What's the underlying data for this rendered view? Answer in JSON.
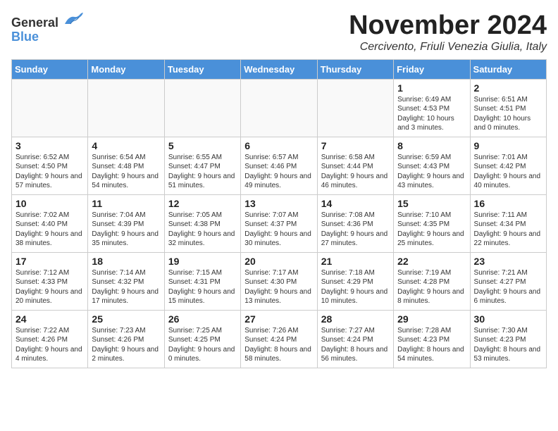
{
  "header": {
    "logo_general": "General",
    "logo_blue": "Blue",
    "month_title": "November 2024",
    "location": "Cercivento, Friuli Venezia Giulia, Italy"
  },
  "weekdays": [
    "Sunday",
    "Monday",
    "Tuesday",
    "Wednesday",
    "Thursday",
    "Friday",
    "Saturday"
  ],
  "weeks": [
    [
      {
        "day": "",
        "info": ""
      },
      {
        "day": "",
        "info": ""
      },
      {
        "day": "",
        "info": ""
      },
      {
        "day": "",
        "info": ""
      },
      {
        "day": "",
        "info": ""
      },
      {
        "day": "1",
        "info": "Sunrise: 6:49 AM\nSunset: 4:53 PM\nDaylight: 10 hours\nand 3 minutes."
      },
      {
        "day": "2",
        "info": "Sunrise: 6:51 AM\nSunset: 4:51 PM\nDaylight: 10 hours\nand 0 minutes."
      }
    ],
    [
      {
        "day": "3",
        "info": "Sunrise: 6:52 AM\nSunset: 4:50 PM\nDaylight: 9 hours\nand 57 minutes."
      },
      {
        "day": "4",
        "info": "Sunrise: 6:54 AM\nSunset: 4:48 PM\nDaylight: 9 hours\nand 54 minutes."
      },
      {
        "day": "5",
        "info": "Sunrise: 6:55 AM\nSunset: 4:47 PM\nDaylight: 9 hours\nand 51 minutes."
      },
      {
        "day": "6",
        "info": "Sunrise: 6:57 AM\nSunset: 4:46 PM\nDaylight: 9 hours\nand 49 minutes."
      },
      {
        "day": "7",
        "info": "Sunrise: 6:58 AM\nSunset: 4:44 PM\nDaylight: 9 hours\nand 46 minutes."
      },
      {
        "day": "8",
        "info": "Sunrise: 6:59 AM\nSunset: 4:43 PM\nDaylight: 9 hours\nand 43 minutes."
      },
      {
        "day": "9",
        "info": "Sunrise: 7:01 AM\nSunset: 4:42 PM\nDaylight: 9 hours\nand 40 minutes."
      }
    ],
    [
      {
        "day": "10",
        "info": "Sunrise: 7:02 AM\nSunset: 4:40 PM\nDaylight: 9 hours\nand 38 minutes."
      },
      {
        "day": "11",
        "info": "Sunrise: 7:04 AM\nSunset: 4:39 PM\nDaylight: 9 hours\nand 35 minutes."
      },
      {
        "day": "12",
        "info": "Sunrise: 7:05 AM\nSunset: 4:38 PM\nDaylight: 9 hours\nand 32 minutes."
      },
      {
        "day": "13",
        "info": "Sunrise: 7:07 AM\nSunset: 4:37 PM\nDaylight: 9 hours\nand 30 minutes."
      },
      {
        "day": "14",
        "info": "Sunrise: 7:08 AM\nSunset: 4:36 PM\nDaylight: 9 hours\nand 27 minutes."
      },
      {
        "day": "15",
        "info": "Sunrise: 7:10 AM\nSunset: 4:35 PM\nDaylight: 9 hours\nand 25 minutes."
      },
      {
        "day": "16",
        "info": "Sunrise: 7:11 AM\nSunset: 4:34 PM\nDaylight: 9 hours\nand 22 minutes."
      }
    ],
    [
      {
        "day": "17",
        "info": "Sunrise: 7:12 AM\nSunset: 4:33 PM\nDaylight: 9 hours\nand 20 minutes."
      },
      {
        "day": "18",
        "info": "Sunrise: 7:14 AM\nSunset: 4:32 PM\nDaylight: 9 hours\nand 17 minutes."
      },
      {
        "day": "19",
        "info": "Sunrise: 7:15 AM\nSunset: 4:31 PM\nDaylight: 9 hours\nand 15 minutes."
      },
      {
        "day": "20",
        "info": "Sunrise: 7:17 AM\nSunset: 4:30 PM\nDaylight: 9 hours\nand 13 minutes."
      },
      {
        "day": "21",
        "info": "Sunrise: 7:18 AM\nSunset: 4:29 PM\nDaylight: 9 hours\nand 10 minutes."
      },
      {
        "day": "22",
        "info": "Sunrise: 7:19 AM\nSunset: 4:28 PM\nDaylight: 9 hours\nand 8 minutes."
      },
      {
        "day": "23",
        "info": "Sunrise: 7:21 AM\nSunset: 4:27 PM\nDaylight: 9 hours\nand 6 minutes."
      }
    ],
    [
      {
        "day": "24",
        "info": "Sunrise: 7:22 AM\nSunset: 4:26 PM\nDaylight: 9 hours\nand 4 minutes."
      },
      {
        "day": "25",
        "info": "Sunrise: 7:23 AM\nSunset: 4:26 PM\nDaylight: 9 hours\nand 2 minutes."
      },
      {
        "day": "26",
        "info": "Sunrise: 7:25 AM\nSunset: 4:25 PM\nDaylight: 9 hours\nand 0 minutes."
      },
      {
        "day": "27",
        "info": "Sunrise: 7:26 AM\nSunset: 4:24 PM\nDaylight: 8 hours\nand 58 minutes."
      },
      {
        "day": "28",
        "info": "Sunrise: 7:27 AM\nSunset: 4:24 PM\nDaylight: 8 hours\nand 56 minutes."
      },
      {
        "day": "29",
        "info": "Sunrise: 7:28 AM\nSunset: 4:23 PM\nDaylight: 8 hours\nand 54 minutes."
      },
      {
        "day": "30",
        "info": "Sunrise: 7:30 AM\nSunset: 4:23 PM\nDaylight: 8 hours\nand 53 minutes."
      }
    ]
  ]
}
